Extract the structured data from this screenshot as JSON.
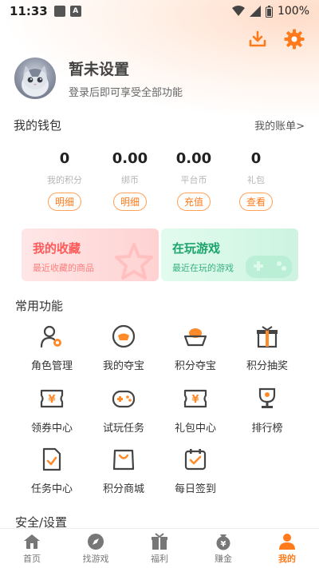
{
  "status_bar": {
    "time": "11:33",
    "battery": "100%"
  },
  "profile": {
    "name": "暂未设置",
    "subtitle": "登录后即可享受全部功能"
  },
  "wallet": {
    "title": "我的钱包",
    "account_link": "我的账单>",
    "stats": [
      {
        "value": "0",
        "label": "我的积分",
        "button": "明细"
      },
      {
        "value": "0.00",
        "label": "绑币",
        "button": "明细"
      },
      {
        "value": "0.00",
        "label": "平台币",
        "button": "充值"
      },
      {
        "value": "0",
        "label": "礼包",
        "button": "查看"
      }
    ]
  },
  "cards": {
    "favorites": {
      "title": "我的收藏",
      "subtitle": "最近收藏的商品"
    },
    "playing": {
      "title": "在玩游戏",
      "subtitle": "最近在玩的游戏"
    }
  },
  "common_functions": {
    "title": "常用功能",
    "items": [
      {
        "label": "角色管理",
        "icon": "role-manage-icon"
      },
      {
        "label": "我的夺宝",
        "icon": "treasure-icon"
      },
      {
        "label": "积分夺宝",
        "icon": "ingot-icon"
      },
      {
        "label": "积分抽奖",
        "icon": "gift-box-icon"
      },
      {
        "label": "领券中心",
        "icon": "coupon-icon"
      },
      {
        "label": "试玩任务",
        "icon": "gamepad-icon"
      },
      {
        "label": "礼包中心",
        "icon": "gift-ticket-icon"
      },
      {
        "label": "排行榜",
        "icon": "trophy-icon"
      },
      {
        "label": "任务中心",
        "icon": "task-icon"
      },
      {
        "label": "积分商城",
        "icon": "shopping-bag-icon"
      },
      {
        "label": "每日签到",
        "icon": "calendar-check-icon"
      }
    ]
  },
  "security": {
    "title": "安全/设置"
  },
  "tabs": [
    {
      "label": "首页",
      "icon": "home-icon",
      "active": false
    },
    {
      "label": "找游戏",
      "icon": "compass-icon",
      "active": false
    },
    {
      "label": "福利",
      "icon": "gift-icon",
      "active": false
    },
    {
      "label": "赚金",
      "icon": "money-bag-icon",
      "active": false
    },
    {
      "label": "我的",
      "icon": "user-icon",
      "active": true
    }
  ],
  "colors": {
    "accent": "#ff7a1a",
    "favorites": "#ff5a5a",
    "playing": "#1ba36a"
  }
}
